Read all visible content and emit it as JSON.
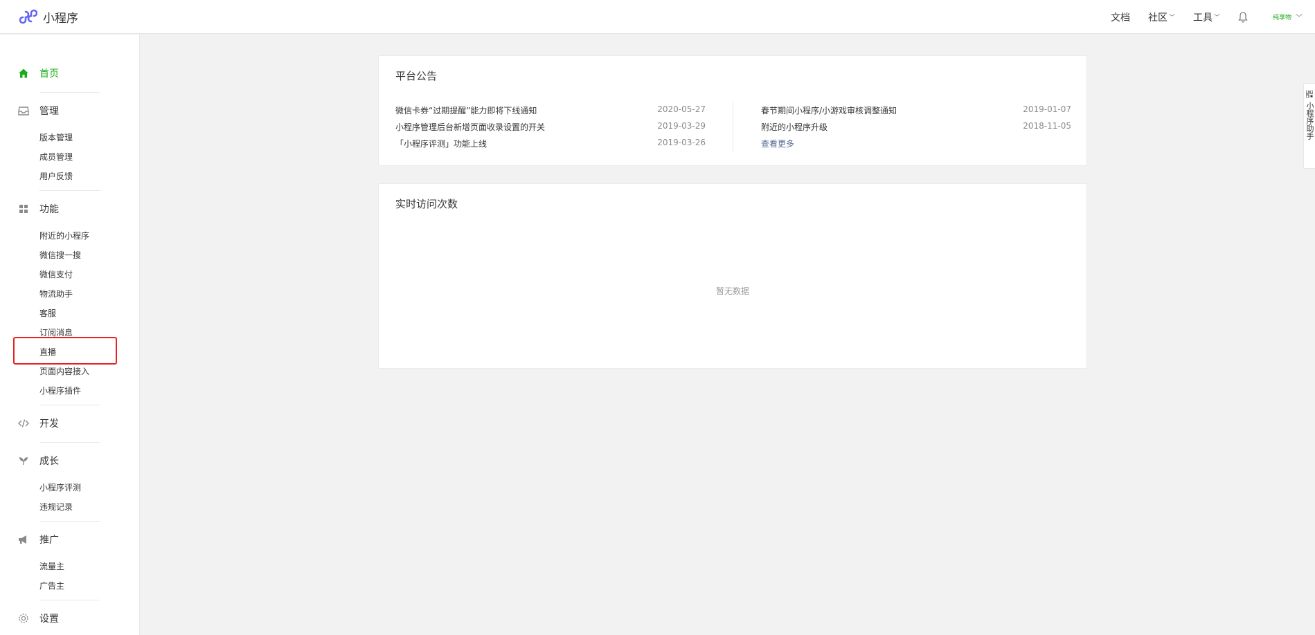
{
  "header": {
    "brand_name": "小程序",
    "nav": {
      "docs": "文档",
      "community": "社区",
      "tools": "工具"
    },
    "account_name": "纯享物",
    "brand_color": "#1aad19"
  },
  "sidebar": {
    "home": "首页",
    "manage": {
      "label": "管理",
      "items": [
        "版本管理",
        "成员管理",
        "用户反馈"
      ]
    },
    "features": {
      "label": "功能",
      "items": [
        "附近的小程序",
        "微信搜一搜",
        "微信支付",
        "物流助手",
        "客服",
        "订阅消息",
        "直播",
        "页面内容接入",
        "小程序插件"
      ]
    },
    "develop": "开发",
    "growth": {
      "label": "成长",
      "items": [
        "小程序评测",
        "违规记录"
      ]
    },
    "promote": {
      "label": "推广",
      "items": [
        "流量主",
        "广告主"
      ]
    },
    "settings": "设置"
  },
  "announcements": {
    "title": "平台公告",
    "left": [
      {
        "title": "微信卡券“过期提醒”能力即将下线通知",
        "date": "2020-05-27"
      },
      {
        "title": "小程序管理后台新增页面收录设置的开关",
        "date": "2019-03-29"
      },
      {
        "title": "「小程序评测」功能上线",
        "date": "2019-03-26"
      }
    ],
    "right": [
      {
        "title": "春节期间小程序/小游戏审核调整通知",
        "date": "2019-01-07"
      },
      {
        "title": "附近的小程序升级",
        "date": "2018-11-05"
      }
    ],
    "more": "查看更多"
  },
  "realtime": {
    "title": "实时访问次数",
    "empty": "暂无数据"
  },
  "side_tab": {
    "text": "小程序助手"
  }
}
